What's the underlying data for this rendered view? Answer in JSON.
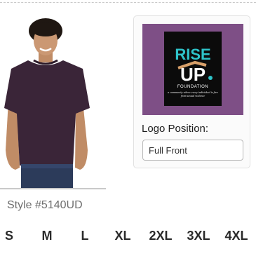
{
  "product": {
    "style_label": "Style #5140UD",
    "shirt_color": "#3a2538",
    "image_alt": "model wearing t-shirt"
  },
  "logo_panel": {
    "logo_background": "#7e4f86",
    "logo_text": {
      "line1": "RISE",
      "line2": "UP",
      "line3": "FOUNDATION",
      "tagline": "a community where every individual is free from sexual violence"
    },
    "position_label": "Logo Position:",
    "position_value": "Full Front"
  },
  "sizes": [
    "S",
    "M",
    "L",
    "XL",
    "2XL",
    "3XL",
    "4XL"
  ]
}
